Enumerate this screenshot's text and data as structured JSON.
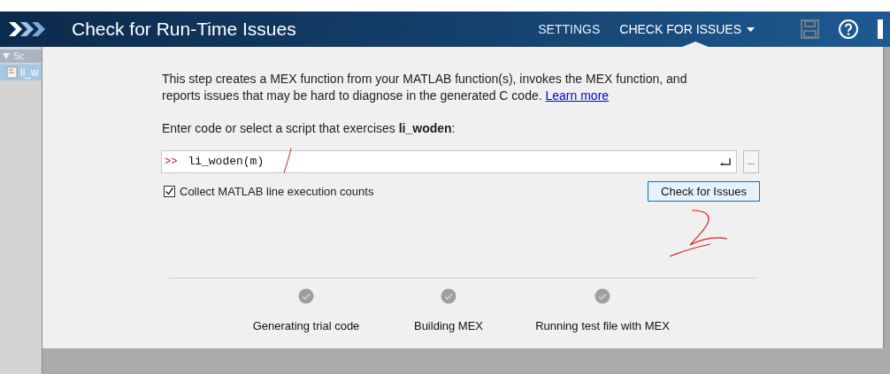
{
  "header": {
    "title": "Check for Run-Time Issues",
    "tabs": [
      {
        "label": "SETTINGS",
        "selected": false,
        "has_menu": false
      },
      {
        "label": "CHECK FOR ISSUES",
        "selected": true,
        "has_menu": true
      }
    ]
  },
  "sidebar": {
    "section": {
      "label": "Sc",
      "expanded": true
    },
    "items": [
      {
        "label": "li_w",
        "selected": true
      }
    ]
  },
  "description": {
    "text": "This step creates a MEX function from your MATLAB function(s), invokes the MEX function, and reports issues that may be hard to diagnose in the generated C code.",
    "link": "Learn more"
  },
  "entry_label": "Enter code or select a script that exercises **li_woden**:",
  "command": {
    "prompt": ">>",
    "value": "li_woden(m)",
    "browse": "..."
  },
  "collect_counts": {
    "label": "Collect MATLAB line execution counts",
    "checked": true
  },
  "check_button": "Check for Issues",
  "steps": [
    {
      "label": "Generating trial code",
      "done": true
    },
    {
      "label": "Building MEX",
      "done": true
    },
    {
      "label": "Running test file with MEX",
      "done": true
    }
  ]
}
